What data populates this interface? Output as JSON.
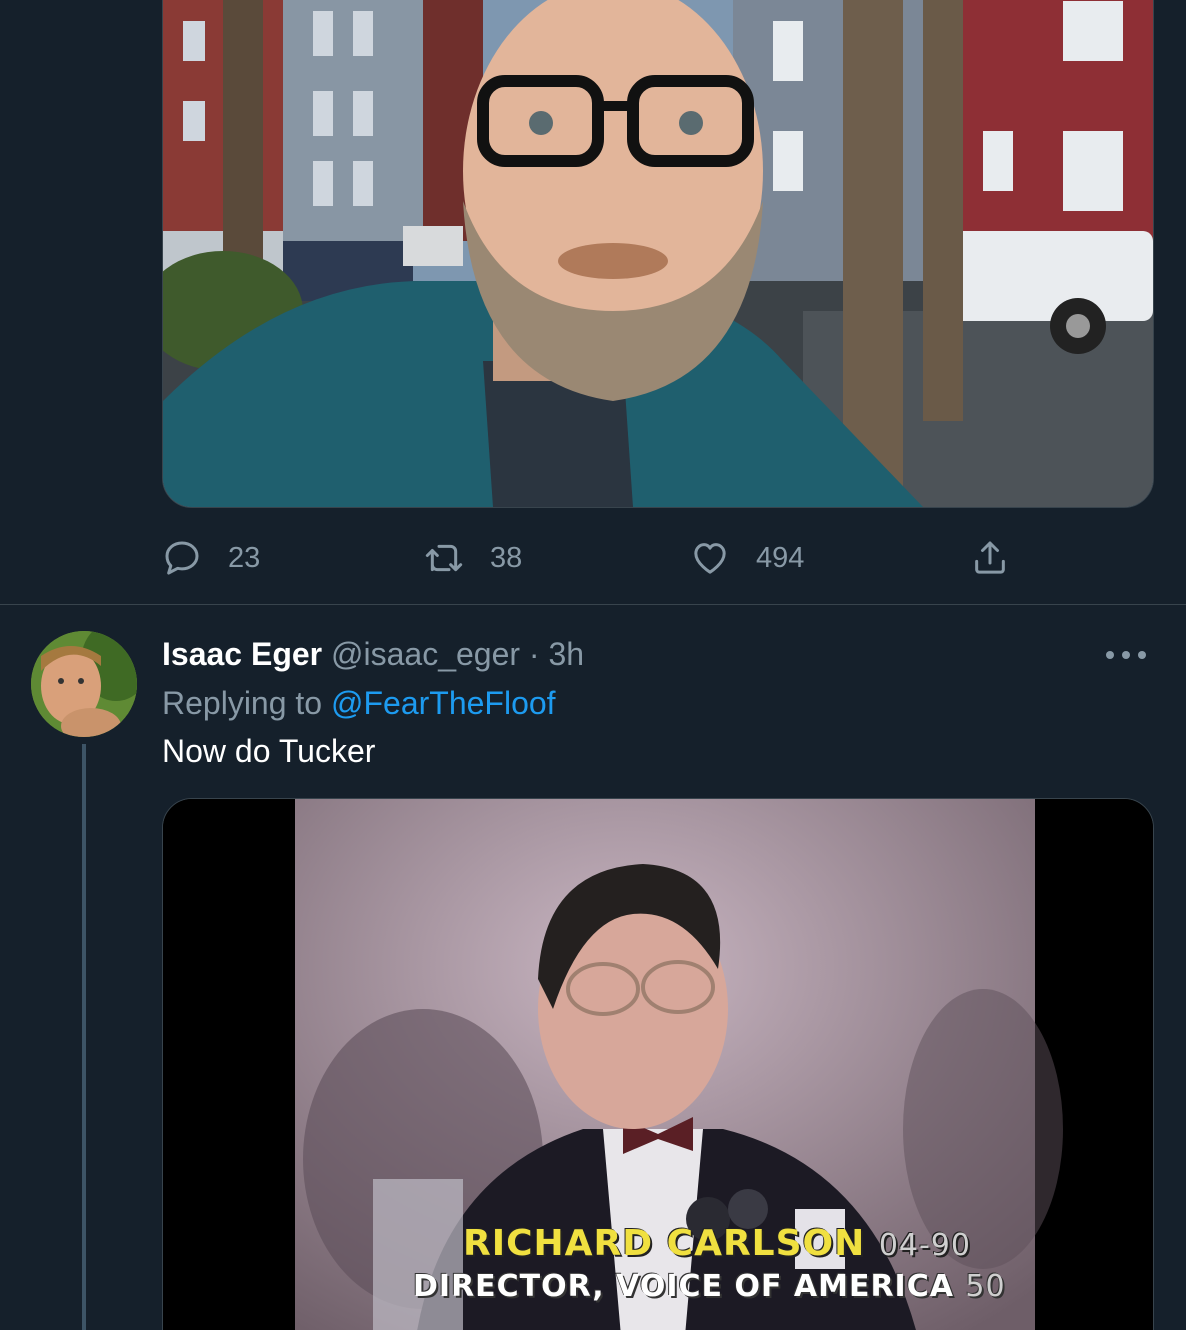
{
  "tweet_top": {
    "image_alt": "Selfie of a bald man with glasses and beard on a city street",
    "stats": {
      "replies": "23",
      "retweets": "38",
      "likes": "494"
    }
  },
  "tweet_reply": {
    "author_name": "Isaac Eger",
    "author_handle": "@isaac_eger",
    "separator": "·",
    "time": "3h",
    "replying_prefix": "Replying to",
    "replying_to": "@FearTheFloof",
    "text": "Now do Tucker",
    "video": {
      "caption_name": "RICHARD CARLSON",
      "caption_title": "DIRECTOR, VOICE OF AMERICA",
      "caption_code_1": "04-90",
      "caption_code_2": "50"
    }
  },
  "colors": {
    "background": "#15202b",
    "muted": "#8899a6",
    "link": "#1d9bf0",
    "border": "#38444d"
  }
}
